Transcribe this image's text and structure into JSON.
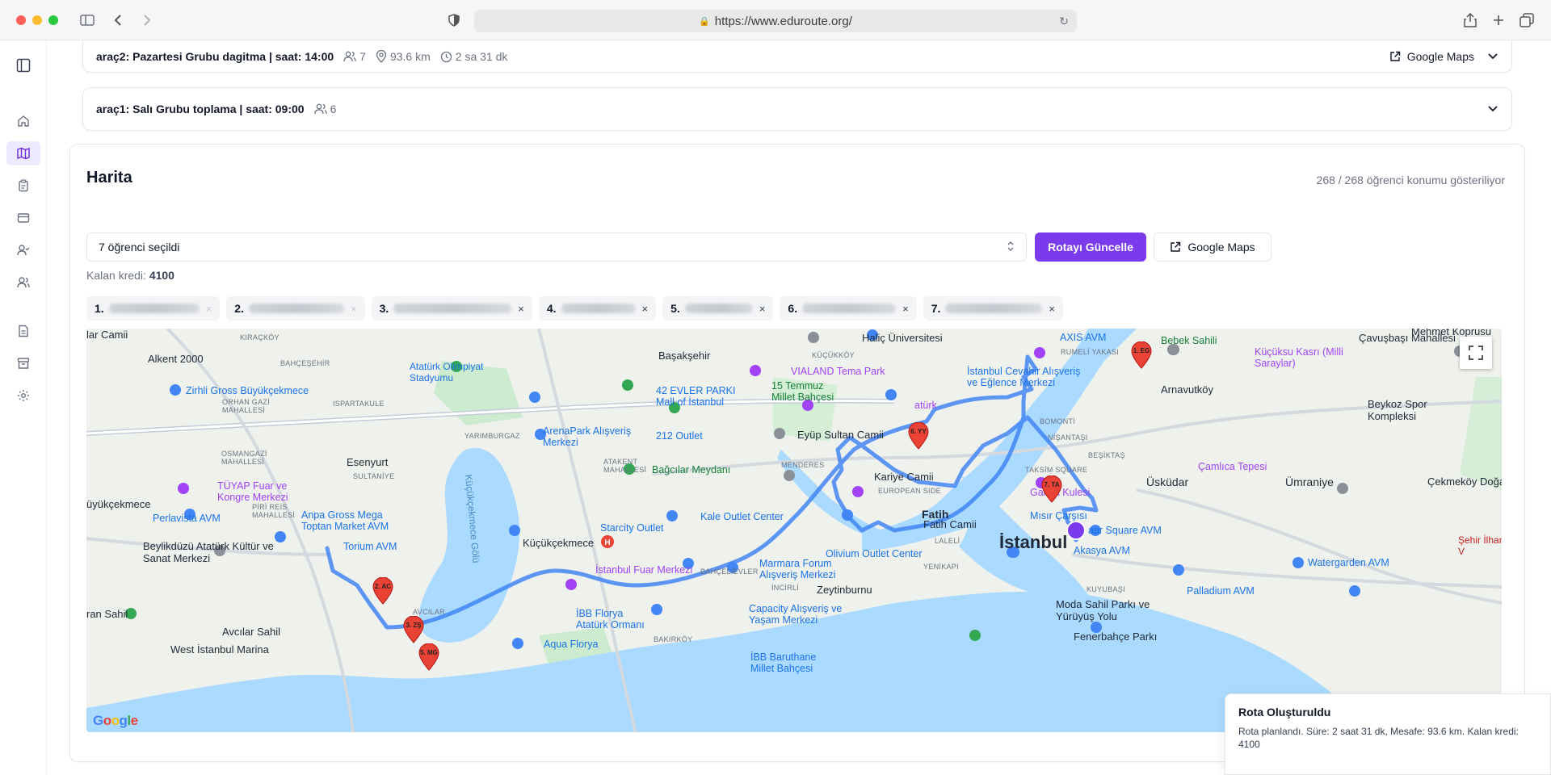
{
  "browser": {
    "url": "https://www.eduroute.org/"
  },
  "routes": [
    {
      "title": "araç2: Pazartesi Grubu dagitma | saat: 14:00",
      "students": "7",
      "distance": "93.6 km",
      "duration": "2 sa 31 dk",
      "maps_label": "Google Maps"
    },
    {
      "title": "araç1: Salı Grubu toplama | saat: 09:00",
      "students": "6"
    }
  ],
  "harita": {
    "title": "Harita",
    "count_text": "268 / 268 öğrenci konumu gösteriliyor",
    "select_value": "7 öğrenci seçildi",
    "update_button": "Rotayı Güncelle",
    "maps_button": "Google Maps",
    "kredi_label": "Kalan kredi:",
    "kredi_value": "4100",
    "chips": [
      {
        "num": "1."
      },
      {
        "num": "2."
      },
      {
        "num": "3."
      },
      {
        "num": "4."
      },
      {
        "num": "5."
      },
      {
        "num": "6."
      },
      {
        "num": "7."
      }
    ]
  },
  "map": {
    "labels": {
      "alkent": "Alkent 2000",
      "esenyurt": "Esenyurt",
      "kucukcekmece_town": "Küçükçekmece",
      "istanbul": "İstanbul",
      "fatih": "Fatih",
      "uskudar": "Üsküdar",
      "umraniye": "Ümraniye",
      "arnavutkoy": "Arnavutköy",
      "basaksehir": "Başakşehir",
      "zeytinburnu": "Zeytinburnu",
      "buyukcekmece": "üyükçekmece",
      "kiraakoy": "KIRAÇKÖY",
      "bahcesehir": "BAHÇEŞEHİR",
      "ispartakule": "ISPARTAKULE",
      "orhangazi": "ORHAN GAZİ MAHALLESİ",
      "osmangazi": "OSMANGAZİ MAHALLESİ",
      "sultaniye": "SULTANİYE",
      "piri_reis": "PİRİ REİS MAHALLESİ",
      "yarimburgaz": "YARIMBURGAZ",
      "atakent": "ATAKENT MAHALLESİ",
      "menderes": "MENDERES",
      "european_side": "EUROPEAN SIDE",
      "kucukkoy": "KÜÇÜKKÖY",
      "rumeli_yakasi": "RUMELİ YAKASI",
      "bomonti": "BOMONTİ",
      "nisantasi": "NİŞANTAŞI",
      "besiktas": "BEŞİKTAŞ",
      "taksim_square": "TAKSİM SQUARE",
      "laleli": "LALELİ",
      "yenikapi": "YENİKAPI",
      "bahcelievler": "BAHÇELİEVLER",
      "incirli": "İNCİRLİ",
      "kuyubasi": "KUYUBAŞI",
      "bakirkoy": "BAKIRKÖY",
      "avcilar": "AVCILAR",
      "kucukcekmece_golu": "Küçükçekmece Gölü",
      "atat_olimpiyat": "Atatürk Olimpiyat Stadyumu",
      "zirhli": "Zirhli Gross Büyükçekmece",
      "tuyap": "TÜYAP Fuar ve Kongre Merkezi",
      "perlavista": "Perlavista AVM",
      "anpa": "Anpa Gross Mega Toptan Market AVM",
      "beylikduzu": "Beylikdüzü Atatürk Kültür ve Sanat Merkezi",
      "torium": "Torium AVM",
      "arena": "ArenaPark Alışveriş Merkezi",
      "mall_istanbul": "42 EVLER PARKI Mall of İstanbul",
      "outlet212": "212 Outlet",
      "bagcilar": "Bağcılar Meydanı",
      "starcity": "Starcity Outlet",
      "kale": "Kale Outlet Center",
      "istanbul_fuar": "İstanbul Fuar Merkezi",
      "ibb_florya": "İBB Florya Atatürk Ormanı",
      "aqua": "Aqua Florya",
      "marmara": "Marmara Forum Alışveriş Merkezi",
      "olivium": "Olivium Outlet Center",
      "capacity": "Capacity Alışveriş ve Yaşam Merkezi",
      "baruthane": "İBB Baruthane Millet Bahçesi",
      "vialand": "VIALAND Tema Park",
      "temmuz": "15 Temmuz Millet Bahçesi",
      "eyup": "Eyüp Sultan Camii",
      "kariye": "Kariye Camii",
      "fatih_camii": "Fatih Camii",
      "misir": "Mısır Çarşısı",
      "galata": "Galata Kulesi",
      "cevahir": "İstanbul Cevahir Alışveriş ve Eğlence Merkezi",
      "axis": "AXIS AVM",
      "halic": "Haliç Üniversitesi",
      "ataturk_mus": "atürk",
      "bebek": "Bebek Sahili",
      "kucuksu": "Küçüksu Kasrı (Milli Saraylar)",
      "beykoz": "Beykoz Spor Kompleksi",
      "camlica": "Çamlıca Tepesi",
      "cekmekoy": "Çekmeköy Doğa",
      "bazaar": "aar Square AVM",
      "akasya": "Akasya AVM",
      "watergarden": "Watergarden AVM",
      "palladium": "Palladium AVM",
      "moda": "Moda Sahil Parkı ve Yürüyüş Yolu",
      "fenerbahce": "Fenerbahçe Parkı",
      "avcilar_sahil": "Avcılar Sahil",
      "west_marina": "West İstanbul Marina",
      "sahil": "ran Sahil",
      "cavusbasi": "Çavuşbaşı Mahallesi",
      "mehmet": "Mehmet Köprüsü",
      "sehir": "Şehir İlhan V",
      "lar_camii": "lar Camii"
    },
    "pins": [
      {
        "name": "1. EG"
      },
      {
        "name": "2. AC"
      },
      {
        "name": "3. ZŞ"
      },
      {
        "name": "5. MG"
      },
      {
        "name": "6. YY"
      },
      {
        "name": "7. TA"
      }
    ],
    "route_color": "#4285f4"
  },
  "toast": {
    "title": "Rota Oluşturuldu",
    "body": "Rota planlandı. Süre: 2 saat 31 dk, Mesafe: 93.6 km. Kalan kredi: 4100"
  },
  "colors": {
    "accent": "#7c3aed",
    "accent_soft": "#ede9fe",
    "pin": "#ea4335",
    "water": "#aadaff"
  }
}
